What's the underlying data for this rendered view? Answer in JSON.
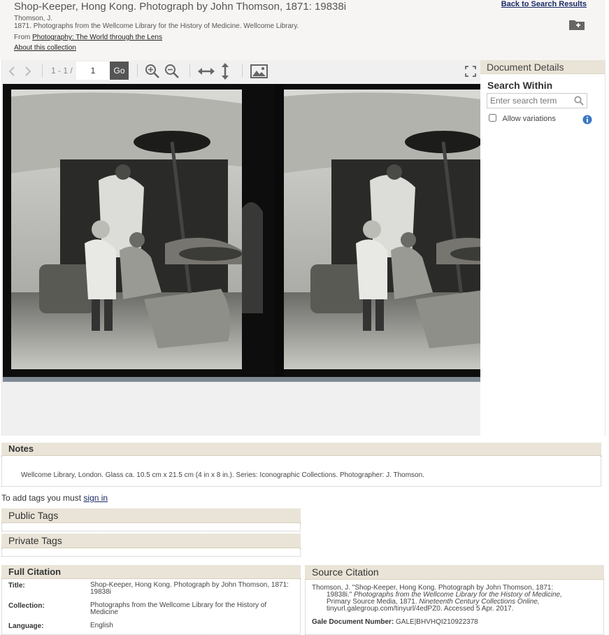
{
  "document": {
    "title": "Shop-Keeper, Hong Kong. Photograph by John Thomson, 1871: 19838i",
    "author": "Thomson, J.",
    "source_line": "1871. Photographs from the Wellcome Library for the History of Medicine. Wellcome Library.",
    "from_prefix": "From",
    "from_link": "Photography: The World through the Lens",
    "about_link": "About this collection"
  },
  "header": {
    "back_link": "Back to Search Results",
    "folder_icon": "folder-add-icon"
  },
  "viewer": {
    "page_range": "1 - 1 /",
    "page_value": "1",
    "go_label": "Go",
    "icons": [
      "prev-arrow-icon",
      "next-arrow-icon",
      "zoom-in-icon",
      "zoom-out-icon",
      "fit-width-icon",
      "fit-height-icon",
      "image-icon",
      "fullscreen-icon"
    ]
  },
  "sidebar": {
    "heading": "Document Details",
    "search_within_label": "Search Within",
    "search_placeholder": "Enter search term",
    "allow_variations_label": "Allow variations"
  },
  "notes": {
    "heading": "Notes",
    "text": "Wellcome Library, London. Glass ca. 10.5 cm x 21.5 cm (4 in x 8 in.). Series: Iconographic Collections. Photographer: J. Thomson."
  },
  "tags": {
    "message_prefix": "To add tags you must",
    "sign_in_link": "sign in",
    "public_heading": "Public Tags",
    "private_heading": "Private Tags"
  },
  "full_citation": {
    "heading": "Full Citation",
    "rows": [
      {
        "label": "Title:",
        "value": "Shop-Keeper, Hong Kong. Photograph by John Thomson, 1871: 19838i"
      },
      {
        "label": "Collection:",
        "value": "Photographs from the Wellcome Library for the History of Medicine"
      },
      {
        "label": "Language:",
        "value": "English"
      }
    ]
  },
  "source_citation": {
    "heading": "Source Citation",
    "line1": "Thomson, J. \"Shop-Keeper, Hong Kong. Photograph by John Thomson, 1871:",
    "line2_plain": "19838i.\"",
    "line2_italic": "Photographs from the Wellcome Library for the History of Medicine,",
    "line3_plain": "Primary Source Media, 1871.",
    "line3_italic": "Nineteenth Century Collections Online,",
    "line4": "tinyurl.galegroup.com/tinyurl/4edPZ0. Accessed 5 Apr. 2017.",
    "gdn_label": "Gale Document Number:",
    "gdn_value": "GALE|BHVHQI210922378"
  }
}
